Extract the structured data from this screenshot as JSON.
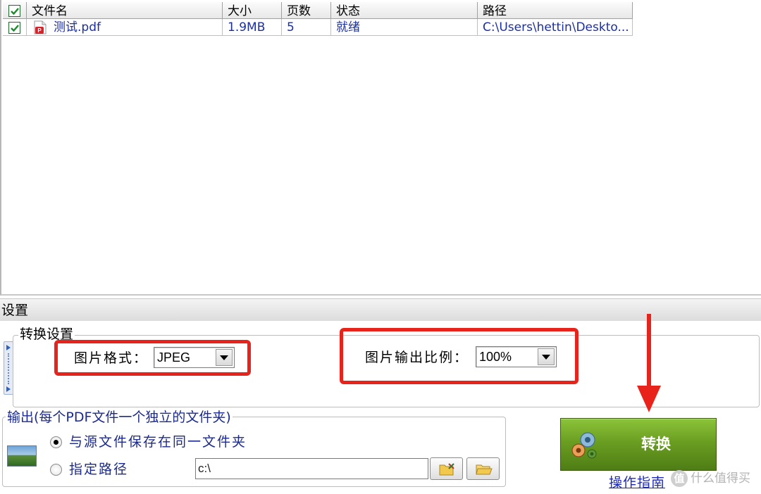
{
  "file_list": {
    "columns": [
      "文件名",
      "大小",
      "页数",
      "状态",
      "路径"
    ],
    "header_checked": true,
    "rows": [
      {
        "checked": true,
        "name": "测试.pdf",
        "size": "1.9MB",
        "pages": "5",
        "status": "就绪",
        "path": "C:\\Users\\hettin\\Deskto..."
      }
    ]
  },
  "settings": {
    "bar_title": "设置",
    "conversion_group": {
      "title": "转换设置",
      "image_format_label": "图片格式：",
      "image_format_value": "JPEG",
      "image_scale_label": "图片输出比例：",
      "image_scale_value": "100%"
    },
    "output_group": {
      "title": "输出(每个PDF文件一个独立的文件夹)",
      "option_same_folder": "与源文件保存在同一文件夹",
      "option_custom_path": "指定路径",
      "selected_option": "same_folder",
      "path_value": "c:\\"
    }
  },
  "actions": {
    "convert_label": "转换",
    "guide_link": "操作指南"
  },
  "watermark": {
    "icon_text": "值",
    "text": "什么值得买"
  },
  "colors": {
    "highlight_red": "#e8231c",
    "convert_green": "#6a9e22",
    "link_blue": "#1e2ab5",
    "list_text_blue": "#1c2fa0"
  }
}
